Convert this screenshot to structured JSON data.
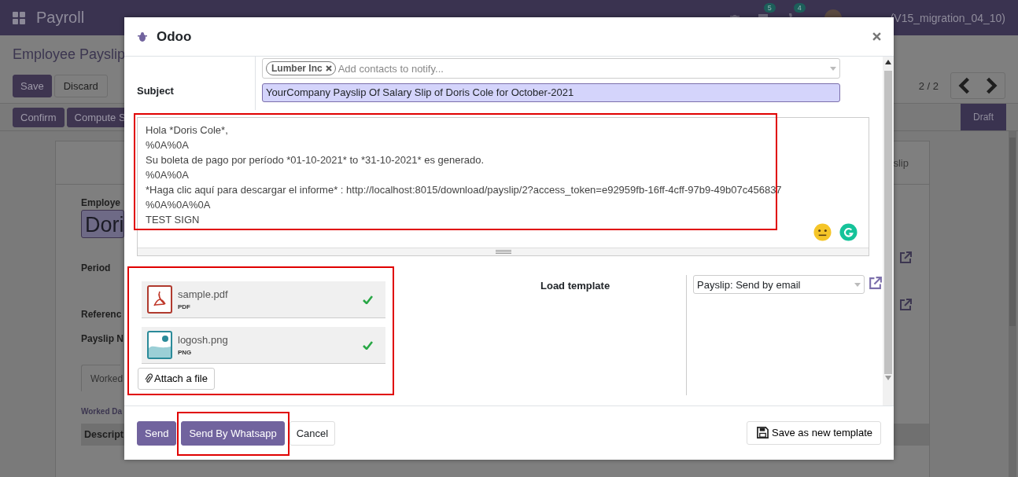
{
  "navbar": {
    "app_title": "Payroll",
    "badges": [
      "5",
      "4"
    ],
    "user": "(V15_migration_04_10)"
  },
  "control_panel": {
    "breadcrumb": "Employee Payslip",
    "buttons": [
      {
        "label": "Save",
        "kind": "primary"
      },
      {
        "label": "Discard",
        "kind": "secondary"
      }
    ],
    "pager": "2 / 2"
  },
  "status_bar": {
    "buttons": [
      "Confirm",
      "Compute S"
    ],
    "stages": [
      {
        "label": "Draft",
        "selected": true
      }
    ]
  },
  "sheet": {
    "tab": "slip",
    "labels": [
      "Employe",
      "Period",
      "Referenc",
      "Payslip N"
    ],
    "employee": "Dori",
    "notebook_tab": "Worked",
    "section": "Worked Da",
    "column": "Descript"
  },
  "dialog": {
    "title": "Odoo",
    "recipients": [
      {
        "label": "Lumber Inc"
      }
    ],
    "recipients_placeholder": "Add contacts to notify...",
    "subject_label": "Subject",
    "subject": "YourCompany Payslip Of Salary Slip of Doris Cole for October-2021",
    "body": {
      "highlighted": true,
      "lines": [
        "Hola *Doris Cole*,",
        "%0A%0A",
        "Su boleta de pago por período *01-10-2021* to *31-10-2021* es generado.",
        "%0A%0A",
        "*Haga clic aquí para descargar el informe* : http://localhost:8015/download/payslip/2?access_token=e92959fb-16ff-4cff-97b9-49b07c456837",
        "%0A%0A%0A",
        "TEST SIGN"
      ]
    },
    "attachments": {
      "highlighted": true,
      "items": [
        {
          "name": "sample.pdf",
          "type": "PDF",
          "kind": "pdf",
          "uploaded": true
        },
        {
          "name": "logosh.png",
          "type": "PNG",
          "kind": "image",
          "uploaded": true
        }
      ]
    },
    "attach_button": "Attach a file",
    "template_label": "Load template",
    "template": "Payslip: Send by email",
    "buttons": [
      {
        "label": "Send",
        "kind": "primary"
      },
      {
        "label": "Send By Whatsapp",
        "kind": "primary",
        "highlighted": true
      },
      {
        "label": "Cancel",
        "kind": "secondary"
      }
    ],
    "save_template": "Save as new template"
  }
}
